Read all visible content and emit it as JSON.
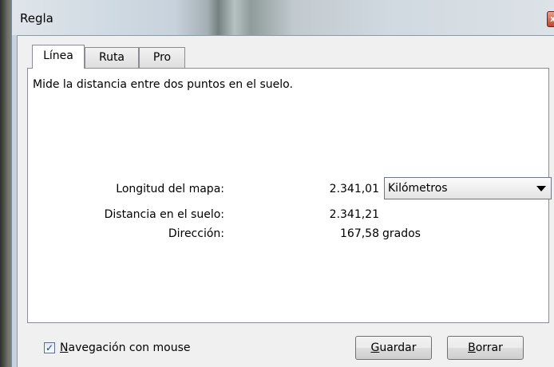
{
  "window": {
    "title": "Regla",
    "close_glyph": "x"
  },
  "tabs": [
    {
      "label": "Línea",
      "active": true
    },
    {
      "label": "Ruta",
      "active": false
    },
    {
      "label": "Pro",
      "active": false
    }
  ],
  "panel": {
    "description": "Mide la distancia entre dos puntos en el suelo.",
    "map_length": {
      "label": "Longitud del mapa:",
      "value": "2.341,01"
    },
    "units_select": {
      "selected": "Kilómetros"
    },
    "ground_distance": {
      "label": "Distancia en el suelo:",
      "value": "2.341,21"
    },
    "direction": {
      "label": "Dirección:",
      "value": "167,58",
      "unit": "grados"
    }
  },
  "footer": {
    "mouse_nav": {
      "checked": true,
      "mnemonic": "N",
      "label_rest": "avegación con mouse"
    },
    "save_button": {
      "mnemonic": "G",
      "label_rest": "uardar"
    },
    "clear_button": {
      "mnemonic": "B",
      "label_rest": "orrar"
    }
  },
  "icons": [
    "close-icon",
    "dropdown-arrow-icon",
    "checkmark-icon"
  ]
}
